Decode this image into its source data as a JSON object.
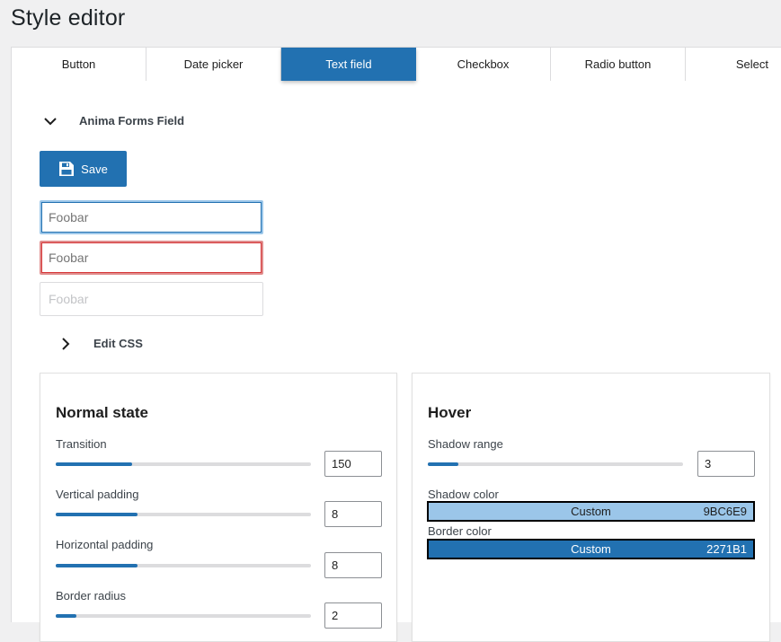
{
  "title": "Style editor",
  "tabs": [
    {
      "label": "Button"
    },
    {
      "label": "Date picker"
    },
    {
      "label": "Text field",
      "active": true
    },
    {
      "label": "Checkbox"
    },
    {
      "label": "Radio button"
    },
    {
      "label": "Select"
    }
  ],
  "section": {
    "label": "Anima Forms Field",
    "icon": "chevron-down-icon"
  },
  "save": {
    "label": "Save",
    "icon": "floppy-disk-icon"
  },
  "fields": [
    {
      "placeholder": "Foobar",
      "state": "focus"
    },
    {
      "placeholder": "Foobar",
      "state": "error"
    },
    {
      "placeholder": "Foobar",
      "state": "disabled"
    }
  ],
  "edit_css": {
    "label": "Edit CSS",
    "icon": "chevron-right-icon"
  },
  "normal": {
    "title": "Normal state",
    "controls": [
      {
        "label": "Transition",
        "value": "150",
        "fill": 0.3
      },
      {
        "label": "Vertical padding",
        "value": "8",
        "fill": 0.32
      },
      {
        "label": "Horizontal padding",
        "value": "8",
        "fill": 0.32
      },
      {
        "label": "Border radius",
        "value": "2",
        "fill": 0.08
      }
    ]
  },
  "hover": {
    "title": "Hover",
    "shadow_range": {
      "label": "Shadow range",
      "value": "3",
      "fill": 0.12
    },
    "shadow_color": {
      "label": "Shadow color",
      "name": "Custom",
      "hex": "9BC6E9",
      "color": "#9bc6e9"
    },
    "border_color": {
      "label": "Border color",
      "name": "Custom",
      "hex": "2271B1",
      "color": "#2271b1"
    }
  },
  "colors": {
    "accent": "#2271b1",
    "focus": "#9bc6e9",
    "error": "#d63638"
  }
}
